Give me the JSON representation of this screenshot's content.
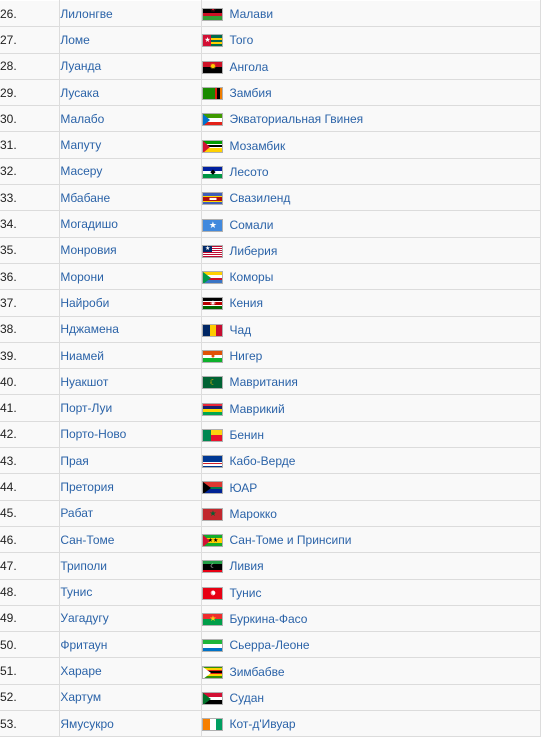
{
  "table": {
    "columns": [
      "number",
      "capital",
      "country"
    ],
    "rows": [
      {
        "num": "26.",
        "capital": "Лилонгве",
        "country": "Малави",
        "flag": "malawi"
      },
      {
        "num": "27.",
        "capital": "Ломе",
        "country": "Того",
        "flag": "togo"
      },
      {
        "num": "28.",
        "capital": "Луанда",
        "country": "Ангола",
        "flag": "angola"
      },
      {
        "num": "29.",
        "capital": "Лусака",
        "country": "Замбия",
        "flag": "zambia"
      },
      {
        "num": "30.",
        "capital": "Малабо",
        "country": "Экваториальная Гвинея",
        "flag": "equatorial-guinea"
      },
      {
        "num": "31.",
        "capital": "Мапуту",
        "country": "Мозамбик",
        "flag": "mozambique"
      },
      {
        "num": "32.",
        "capital": "Масеру",
        "country": "Лесото",
        "flag": "lesotho"
      },
      {
        "num": "33.",
        "capital": "Мбабане",
        "country": "Свазиленд",
        "flag": "swaziland"
      },
      {
        "num": "34.",
        "capital": "Могадишо",
        "country": "Сомали",
        "flag": "somalia"
      },
      {
        "num": "35.",
        "capital": "Монровия",
        "country": "Либерия",
        "flag": "liberia"
      },
      {
        "num": "36.",
        "capital": "Морони",
        "country": "Коморы",
        "flag": "comoros"
      },
      {
        "num": "37.",
        "capital": "Найроби",
        "country": "Кения",
        "flag": "kenya"
      },
      {
        "num": "38.",
        "capital": "Нджамена",
        "country": "Чад",
        "flag": "chad"
      },
      {
        "num": "39.",
        "capital": "Ниамей",
        "country": "Нигер",
        "flag": "niger"
      },
      {
        "num": "40.",
        "capital": "Нуакшот",
        "country": "Мавритания",
        "flag": "mauritania"
      },
      {
        "num": "41.",
        "capital": "Порт-Луи",
        "country": "Маврикий",
        "flag": "mauritius"
      },
      {
        "num": "42.",
        "capital": "Порто-Ново",
        "country": "Бенин",
        "flag": "benin"
      },
      {
        "num": "43.",
        "capital": "Прая",
        "country": "Кабо-Верде",
        "flag": "cape-verde"
      },
      {
        "num": "44.",
        "capital": "Претория",
        "country": "ЮАР",
        "flag": "south-africa"
      },
      {
        "num": "45.",
        "capital": "Рабат",
        "country": "Марокко",
        "flag": "morocco"
      },
      {
        "num": "46.",
        "capital": "Сан-Томе",
        "country": "Сан-Томе и Принсипи",
        "flag": "sao-tome"
      },
      {
        "num": "47.",
        "capital": "Триполи",
        "country": "Ливия",
        "flag": "libya"
      },
      {
        "num": "48.",
        "capital": "Тунис",
        "country": "Тунис",
        "flag": "tunisia"
      },
      {
        "num": "49.",
        "capital": "Уагадугу",
        "country": "Буркина-Фасо",
        "flag": "burkina-faso"
      },
      {
        "num": "50.",
        "capital": "Фритаун",
        "country": "Сьерра-Леоне",
        "flag": "sierra-leone"
      },
      {
        "num": "51.",
        "capital": "Хараре",
        "country": "Зимбабве",
        "flag": "zimbabwe"
      },
      {
        "num": "52.",
        "capital": "Хартум",
        "country": "Судан",
        "flag": "sudan"
      },
      {
        "num": "53.",
        "capital": "Ямусукро",
        "country": "Кот-д'Ивуар",
        "flag": "ivory-coast"
      }
    ]
  },
  "colors": {
    "link": "#2b63a8",
    "row_background": "#f9f9f9",
    "row_border": "#dcdcdc",
    "text": "#222222"
  }
}
